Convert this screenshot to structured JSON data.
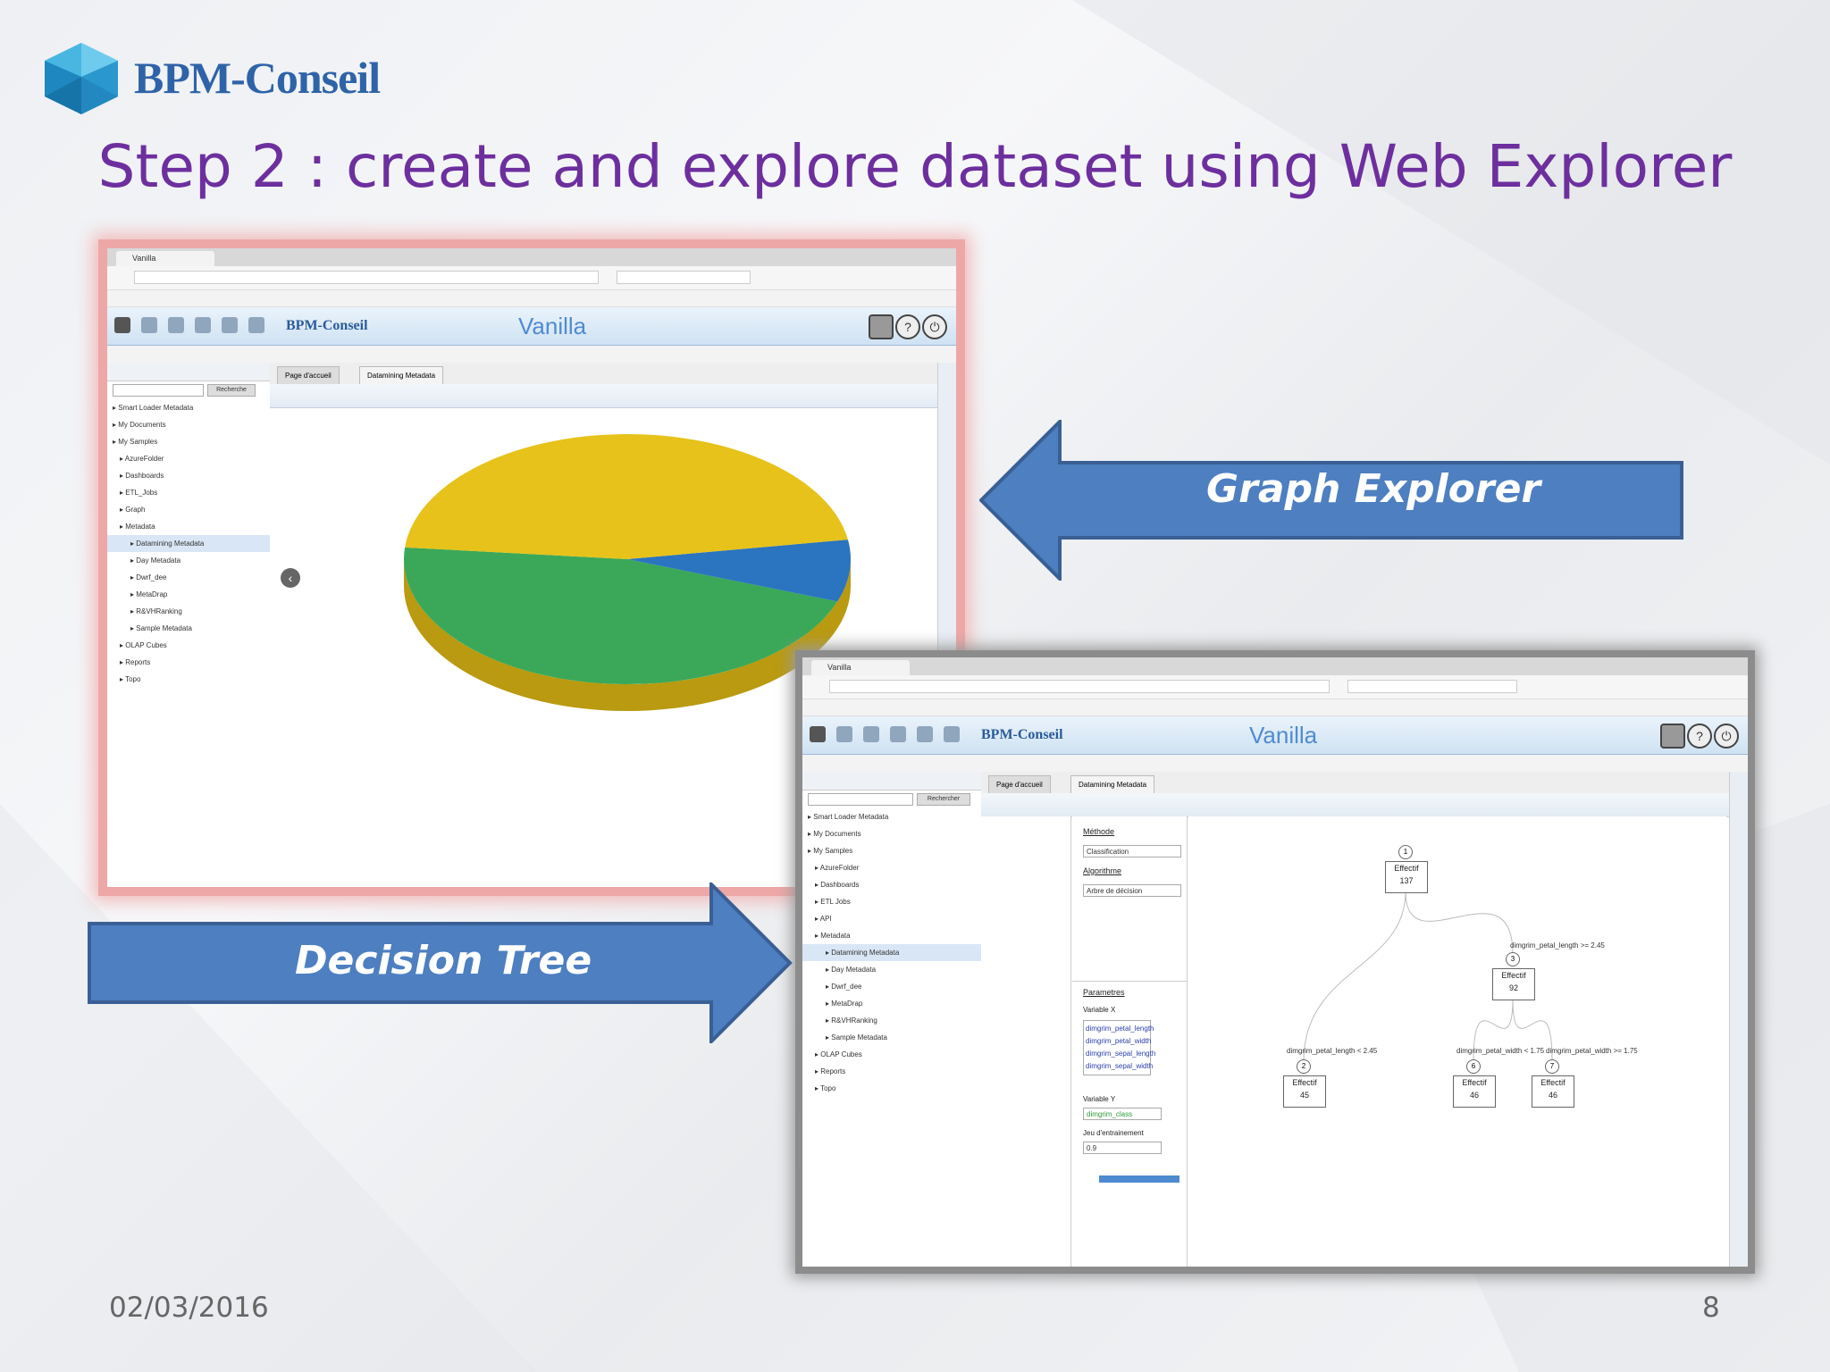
{
  "brand": {
    "name": "BPM-Conseil"
  },
  "slide": {
    "title": "Step 2 : create and explore dataset using Web Explorer",
    "date": "02/03/2016",
    "page_number": "8"
  },
  "callouts": {
    "graph_explorer": "Graph Explorer",
    "decision_tree": "Decision Tree"
  },
  "colors": {
    "title": "#6d2f9e",
    "brand": "#2f63a8",
    "arrow_fill": "#4d7fc1",
    "arrow_border": "#3a5f94"
  },
  "screenshot_graph": {
    "browser_tab": "Vanilla",
    "app_brand": "BPM-Conseil",
    "app_name": "Vanilla",
    "search_button": "Recherche",
    "tabs": [
      "Page d'accueil",
      "Datamining Metadata"
    ],
    "tree": [
      "Smart Loader Metadata",
      "My Documents",
      "My Samples",
      "AzureFolder",
      "Dashboards",
      "ETL_Jobs",
      "Graph",
      "Metadata",
      "Datamining Metadata",
      "Day Metadata",
      "Dwrf_dee",
      "MetaDrap",
      "R&VHRanking",
      "Sample Metadata",
      "OLAP Cubes",
      "Reports",
      "Topo"
    ],
    "chart_data": {
      "type": "pie",
      "slices": [
        {
          "color": "#3aa858",
          "share": 0.46
        },
        {
          "color": "#2a74c0",
          "share": 0.08
        },
        {
          "color": "#e6c21a",
          "share": 0.46
        }
      ]
    }
  },
  "screenshot_tree": {
    "browser_tab": "Vanilla",
    "app_brand": "BPM-Conseil",
    "app_name": "Vanilla",
    "search_button": "Rechercher",
    "tabs": [
      "Page d'accueil",
      "Datamining Metadata"
    ],
    "tree": [
      "Smart Loader Metadata",
      "My Documents",
      "My Samples",
      "AzureFolder",
      "Dashboards",
      "ETL Jobs",
      "API",
      "Metadata",
      "Datamining Metadata",
      "Day Metadata",
      "Dwrf_dee",
      "MetaDrap",
      "R&VHRanking",
      "Sample Metadata",
      "OLAP Cubes",
      "Reports",
      "Topo"
    ],
    "form": {
      "methode_label": "Méthode",
      "methode_value": "Classification",
      "algorithme_label": "Algorithme",
      "algorithme_value": "Arbre de décision",
      "parametres_label": "Parametres",
      "variable_x_label": "Variable X",
      "variables": [
        "dimgrim_petal_length",
        "dimgrim_petal_width",
        "dimgrim_sepal_length",
        "dimgrim_sepal_width"
      ],
      "variable_y_label": "Variable Y",
      "variable_y_value": "dimgrim_class",
      "jeu_label": "Jeu d'entrainement",
      "jeu_value": "0.9"
    },
    "decision_tree": {
      "nodes": [
        {
          "num": "1",
          "label": "Effectif",
          "count": "137"
        },
        {
          "num": "2",
          "label": "Effectif",
          "count": "45"
        },
        {
          "num": "3",
          "label": "Effectif",
          "count": "92"
        },
        {
          "num": "6",
          "label": "Effectif",
          "count": "46"
        },
        {
          "num": "7",
          "label": "Effectif",
          "count": "46"
        }
      ],
      "edges": [
        "dimgrim_petal_length < 2.45",
        "dimgrim_petal_length >= 2.45",
        "dimgrim_petal_width < 1.75",
        "dimgrim_petal_width >= 1.75"
      ]
    }
  }
}
